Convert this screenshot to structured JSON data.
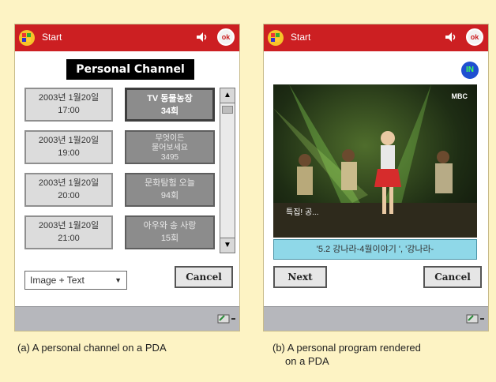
{
  "panel_a": {
    "start_label": "Start",
    "header": "Personal Channel",
    "schedule": [
      {
        "date": "2003년 1월20일",
        "time": "17:00",
        "program_line1": "TV 동물농장",
        "program_line2": "34회"
      },
      {
        "date": "2003년 1월20일",
        "time": "19:00",
        "program_line1": "무엇이든",
        "program_line2": "물어보세요",
        "program_line3": "3495"
      },
      {
        "date": "2003년 1월20일",
        "time": "20:00",
        "program_line1": "문화탐험 오늘",
        "program_line2": "94회"
      },
      {
        "date": "2003년 1월20일",
        "time": "21:00",
        "program_line1": "아우와 송 사랑",
        "program_line2": "15회"
      }
    ],
    "mode_select": "Image + Text",
    "cancel_label": "Cancel",
    "ok_label": "ok",
    "figure_caption": "(a) A personal channel on a PDA"
  },
  "panel_b": {
    "start_label": "Start",
    "in_badge": "IN",
    "channel_logo": "MBC",
    "video_subtitle": "특집! 공...",
    "caption_text": "'5.2 강나라-4월이야기 ', '강나라-",
    "next_label": "Next",
    "cancel_label": "Cancel",
    "ok_label": "ok",
    "figure_caption_line1": "(b) A personal program rendered",
    "figure_caption_line2": "on a PDA"
  },
  "colors": {
    "page_bg": "#fdf3c4",
    "titlebar": "#cc1f22",
    "caption_bar": "#8fd8e8",
    "in_badge": "#1f4fd1"
  },
  "icons": [
    "windows-start-icon",
    "speaker-icon",
    "ok-close-icon",
    "keyboard-input-icon",
    "scroll-up-icon",
    "scroll-down-icon",
    "dropdown-caret-icon"
  ]
}
